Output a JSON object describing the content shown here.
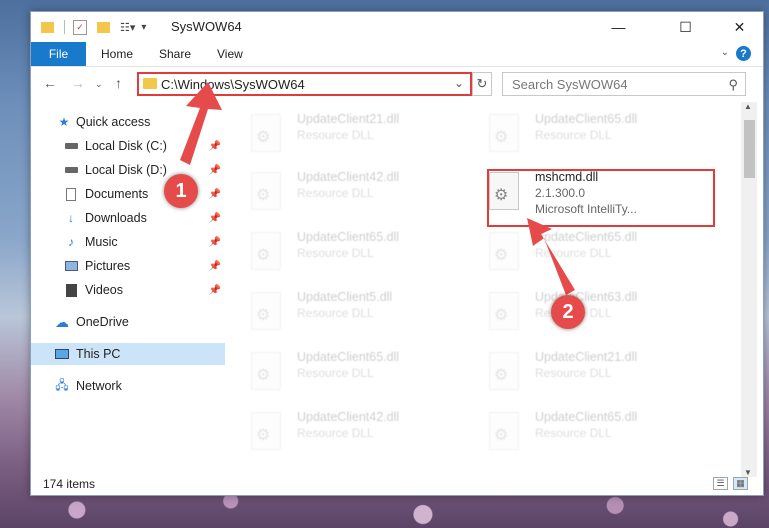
{
  "window": {
    "title": "SysWOW64"
  },
  "ribbon": {
    "file": "File",
    "tabs": [
      "Home",
      "Share",
      "View"
    ],
    "help": "?"
  },
  "address": {
    "path": "C:\\Windows\\SysWOW64"
  },
  "search": {
    "placeholder": "Search SysWOW64"
  },
  "sidebar": {
    "items": [
      {
        "label": "Quick access",
        "icon": "star-icon"
      },
      {
        "label": "Local Disk (C:)",
        "icon": "drive-icon"
      },
      {
        "label": "Local Disk (D:)",
        "icon": "drive-icon"
      },
      {
        "label": "Documents",
        "icon": "documents-icon"
      },
      {
        "label": "Downloads",
        "icon": "downloads-icon"
      },
      {
        "label": "Music",
        "icon": "music-icon"
      },
      {
        "label": "Pictures",
        "icon": "pictures-icon"
      },
      {
        "label": "Videos",
        "icon": "videos-icon"
      },
      {
        "label": "OneDrive",
        "icon": "onedrive-icon"
      },
      {
        "label": "This PC",
        "icon": "pc-icon"
      },
      {
        "label": "Network",
        "icon": "network-icon"
      }
    ]
  },
  "files": [
    {
      "name": "UpdateClient21.dll",
      "type": "Resource DLL"
    },
    {
      "name": "UpdateClient65.dll",
      "type": "Resource DLL"
    },
    {
      "name": "UpdateClient42.dll",
      "type": "Resource DLL"
    },
    {
      "name": "mshcmd.dll",
      "version": "2.1.300.0",
      "company": "Microsoft IntelliTy..."
    },
    {
      "name": "UpdateClient65.dll",
      "type": "Resource DLL"
    },
    {
      "name": "UpdateClient65.dll",
      "type": "Resource DLL"
    },
    {
      "name": "UpdateClient5.dll",
      "type": "Resource DLL"
    },
    {
      "name": "UpdateClient63.dll",
      "type": "Resource DLL"
    },
    {
      "name": "UpdateClient65.dll",
      "type": "Resource DLL"
    },
    {
      "name": "UpdateClient21.dll",
      "type": "Resource DLL"
    },
    {
      "name": "UpdateClient42.dll",
      "type": "Resource DLL"
    },
    {
      "name": "UpdateClient65.dll",
      "type": "Resource DLL"
    }
  ],
  "status": {
    "items": "174 items"
  },
  "callouts": [
    "1",
    "2"
  ],
  "colors": {
    "accent": "#1979ca",
    "highlight": "#e23b3b",
    "callout": "#e64b4b"
  }
}
